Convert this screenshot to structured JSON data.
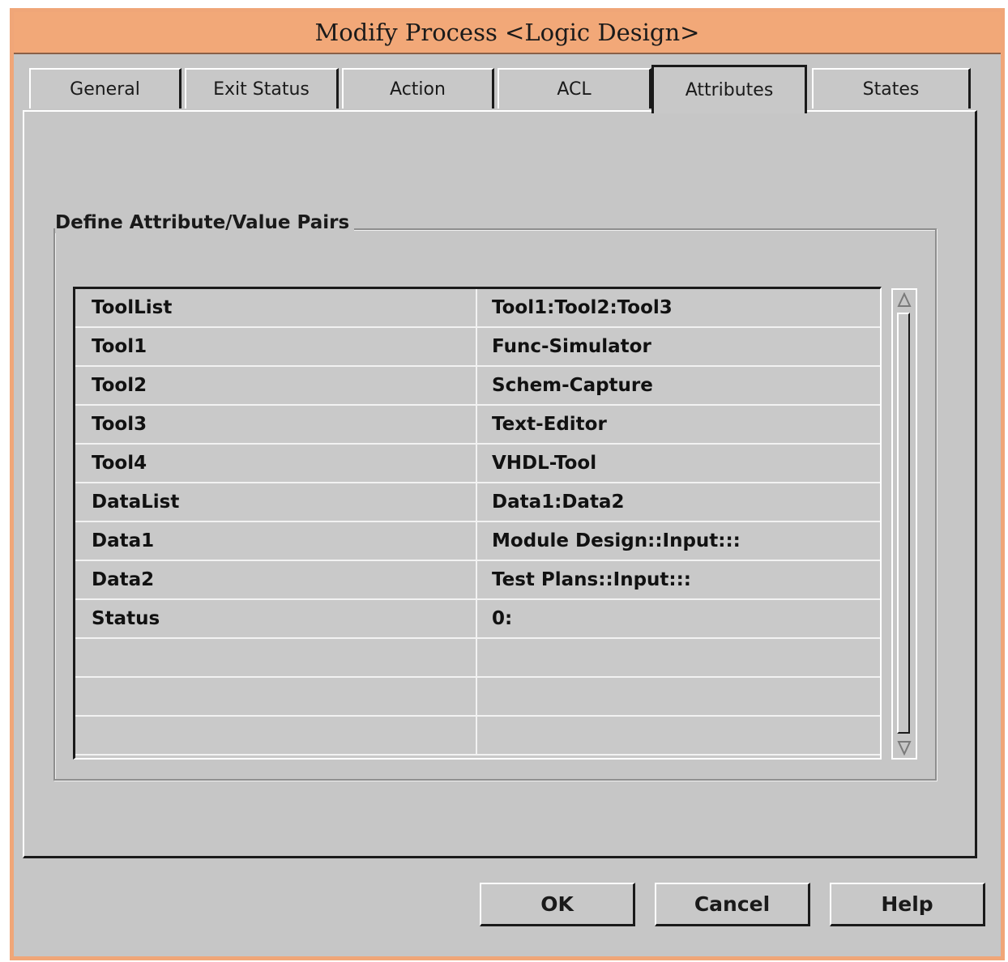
{
  "window": {
    "title": "Modify Process <Logic Design>"
  },
  "tabs": [
    {
      "label": "General",
      "active": false
    },
    {
      "label": "Exit Status",
      "active": false
    },
    {
      "label": "Action",
      "active": false
    },
    {
      "label": "ACL",
      "active": false
    },
    {
      "label": "Attributes",
      "active": true
    },
    {
      "label": "States",
      "active": false
    }
  ],
  "attributes": {
    "group_label": "Define Attribute/Value Pairs",
    "rows": [
      {
        "attribute": "ToolList",
        "value": "Tool1:Tool2:Tool3"
      },
      {
        "attribute": "Tool1",
        "value": "Func-Simulator"
      },
      {
        "attribute": "Tool2",
        "value": "Schem-Capture"
      },
      {
        "attribute": "Tool3",
        "value": "Text-Editor"
      },
      {
        "attribute": "Tool4",
        "value": "VHDL-Tool"
      },
      {
        "attribute": "DataList",
        "value": "Data1:Data2"
      },
      {
        "attribute": "Data1",
        "value": "Module Design::Input:::"
      },
      {
        "attribute": "Data2",
        "value": "Test Plans::Input:::"
      },
      {
        "attribute": "Status",
        "value": "0:"
      },
      {
        "attribute": "",
        "value": ""
      },
      {
        "attribute": "",
        "value": ""
      },
      {
        "attribute": "",
        "value": ""
      }
    ]
  },
  "buttons": {
    "ok": "OK",
    "cancel": "Cancel",
    "help": "Help"
  },
  "icons": {
    "scroll_up": "scroll-up-arrow-icon",
    "scroll_down": "scroll-down-arrow-icon"
  },
  "colors": {
    "titlebar": "#f2a878",
    "window_bg": "#c6c6c6"
  }
}
